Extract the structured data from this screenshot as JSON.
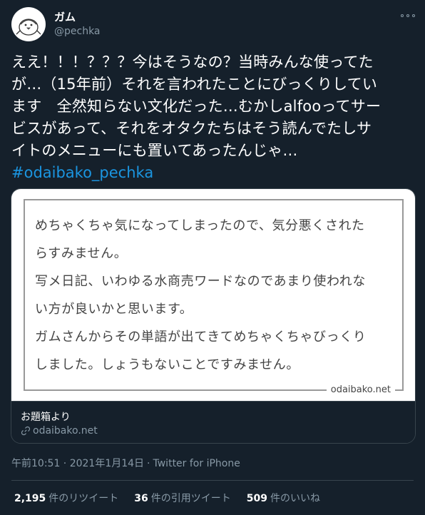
{
  "author": {
    "display_name": "ガム",
    "handle": "@pechka",
    "avatar_icon": "penguin-avatar-icon"
  },
  "tweet": {
    "text": "ええ！！！？？？今はそうなの？当時みんな使ってた\nが…（15年前）それを言われたことにびっくりしてい\nます　全然知らない文化だった…むかしalfooってサー\nビスがあって、それをオタクたちはそう読んでたしサ\nイトのメニューにも置いてあったんじゃ…",
    "hashtag": "#odaibako_pechka"
  },
  "card": {
    "image_text": "めちゃくちゃ気になってしまったので、気分悪くされた\nらすみません。\n写メ日記、いわゆる水商売ワードなのであまり使われな\nい方が良いかと思います。\nガムさんからその単語が出てきてめちゃくちゃびっくり\nしました。しょうもないことですみません。",
    "image_source": "odaibako.net",
    "title": "お題箱より",
    "domain": "odaibako.net"
  },
  "meta": {
    "timestamp": "午前10:51 · 2021年1月14日",
    "separator": "·",
    "source": "Twitter for iPhone"
  },
  "stats": {
    "retweets_count": "2,195",
    "retweets_label": "件のリツイート",
    "quotes_count": "36",
    "quotes_label": "件の引用ツイート",
    "likes_count": "509",
    "likes_label": "件のいいね"
  },
  "colors": {
    "background": "#15202b",
    "text": "#ffffff",
    "secondary": "#8899a6",
    "link": "#1b95e0",
    "border": "#38444d"
  }
}
